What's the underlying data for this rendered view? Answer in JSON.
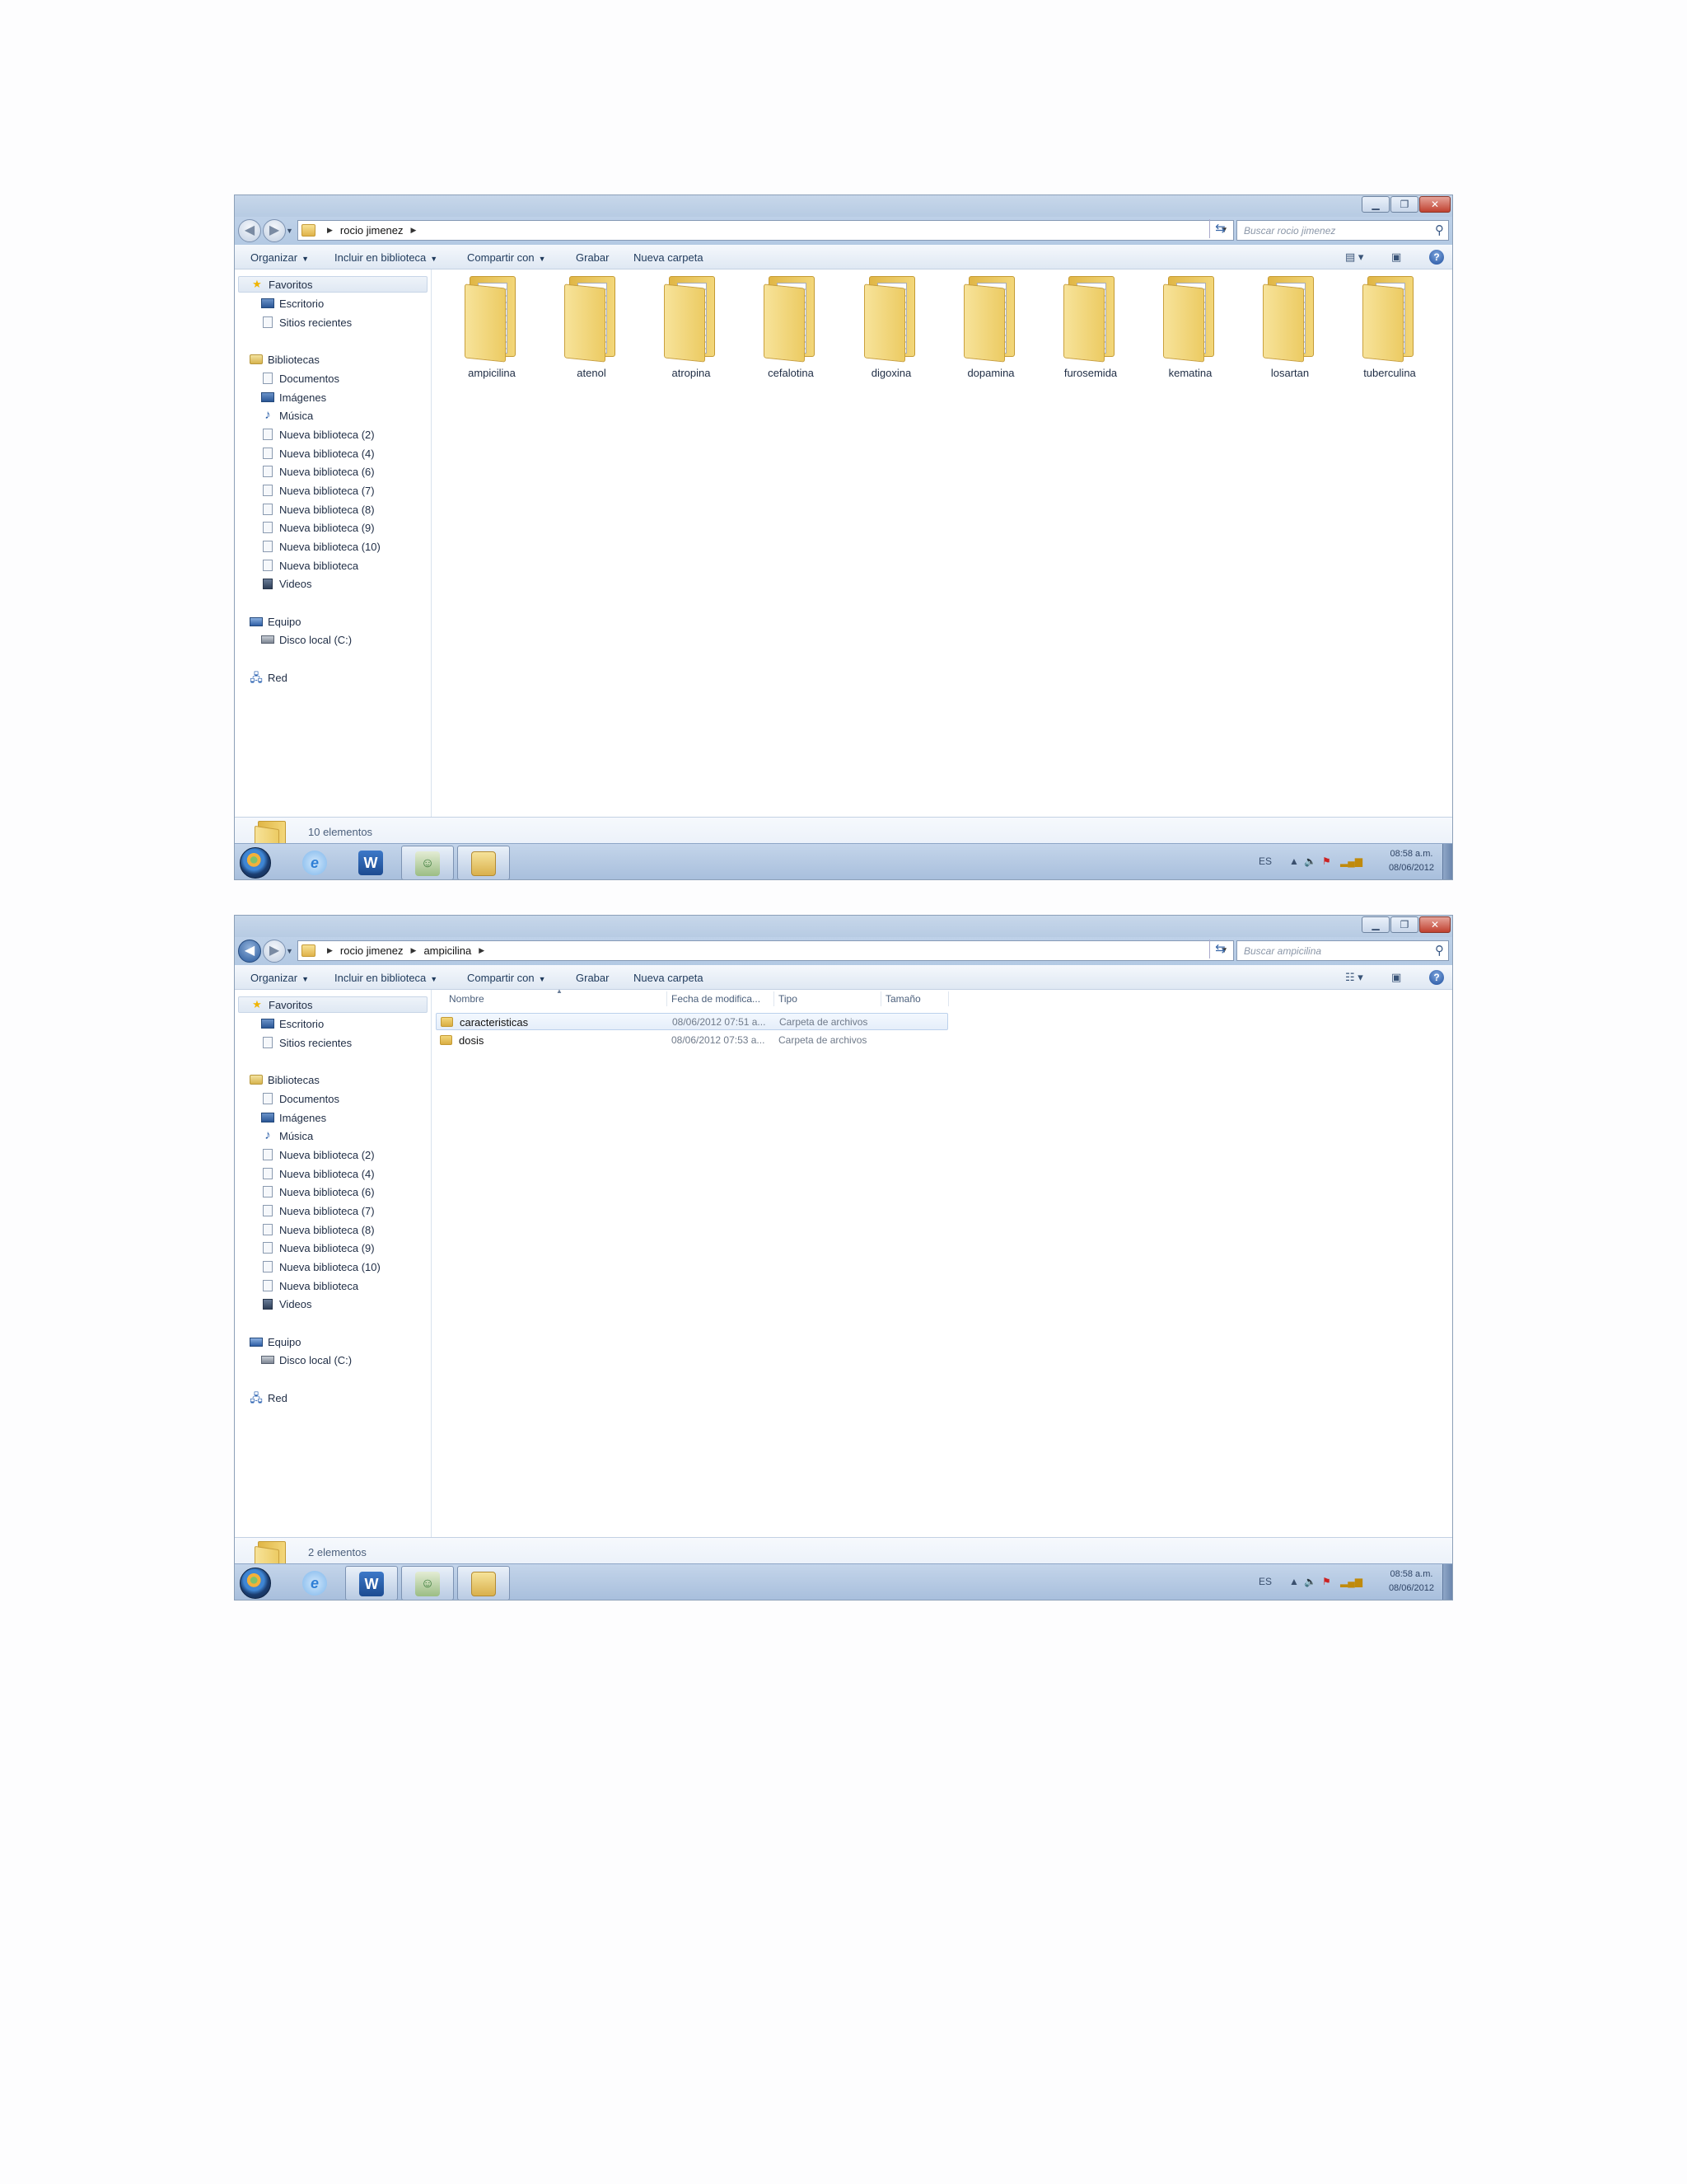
{
  "window1": {
    "breadcrumbs": [
      "rocio jimenez"
    ],
    "search_placeholder": "Buscar rocio jimenez",
    "toolbar": [
      "Organizar",
      "Incluir en biblioteca",
      "Compartir con",
      "Grabar",
      "Nueva carpeta"
    ],
    "folders": [
      "ampicilina",
      "atenol",
      "atropina",
      "cefalotina",
      "digoxina",
      "dopamina",
      "furosemida",
      "kematina",
      "losartan",
      "tuberculina"
    ],
    "status": "10 elementos",
    "tray_lang": "ES",
    "clock_time": "08:58 a.m.",
    "clock_date": "08/06/2012"
  },
  "window2": {
    "breadcrumbs": [
      "rocio jimenez",
      "ampicilina"
    ],
    "search_placeholder": "Buscar ampicilina",
    "toolbar": [
      "Organizar",
      "Incluir en biblioteca",
      "Compartir con",
      "Grabar",
      "Nueva carpeta"
    ],
    "columns": [
      "Nombre",
      "Fecha de modifica...",
      "Tipo",
      "Tamaño"
    ],
    "rows": [
      {
        "name": "caracteristicas",
        "date": "08/06/2012 07:51 a...",
        "type": "Carpeta de archivos"
      },
      {
        "name": "dosis",
        "date": "08/06/2012 07:53 a...",
        "type": "Carpeta de archivos"
      }
    ],
    "status": "2 elementos",
    "tray_lang": "ES",
    "clock_time": "08:58 a.m.",
    "clock_date": "08/06/2012"
  },
  "nav": {
    "favorites": "Favoritos",
    "favorites_items": [
      "Escritorio",
      "Sitios recientes"
    ],
    "libraries": "Bibliotecas",
    "libraries_items": [
      "Documentos",
      "Imágenes",
      "Música",
      "Nueva biblioteca (2)",
      "Nueva biblioteca (4)",
      "Nueva biblioteca (6)",
      "Nueva biblioteca (7)",
      "Nueva biblioteca (8)",
      "Nueva biblioteca (9)",
      "Nueva biblioteca (10)",
      "Nueva biblioteca",
      "Videos"
    ],
    "computer": "Equipo",
    "computer_items": [
      "Disco local (C:)"
    ],
    "network": "Red"
  },
  "icons": {
    "favorites": "star-icon",
    "libraries": "library-icon",
    "computer": "computer-icon",
    "network": "network-icon",
    "search": "search-icon",
    "refresh": "refresh-icon",
    "help": "help-icon"
  }
}
